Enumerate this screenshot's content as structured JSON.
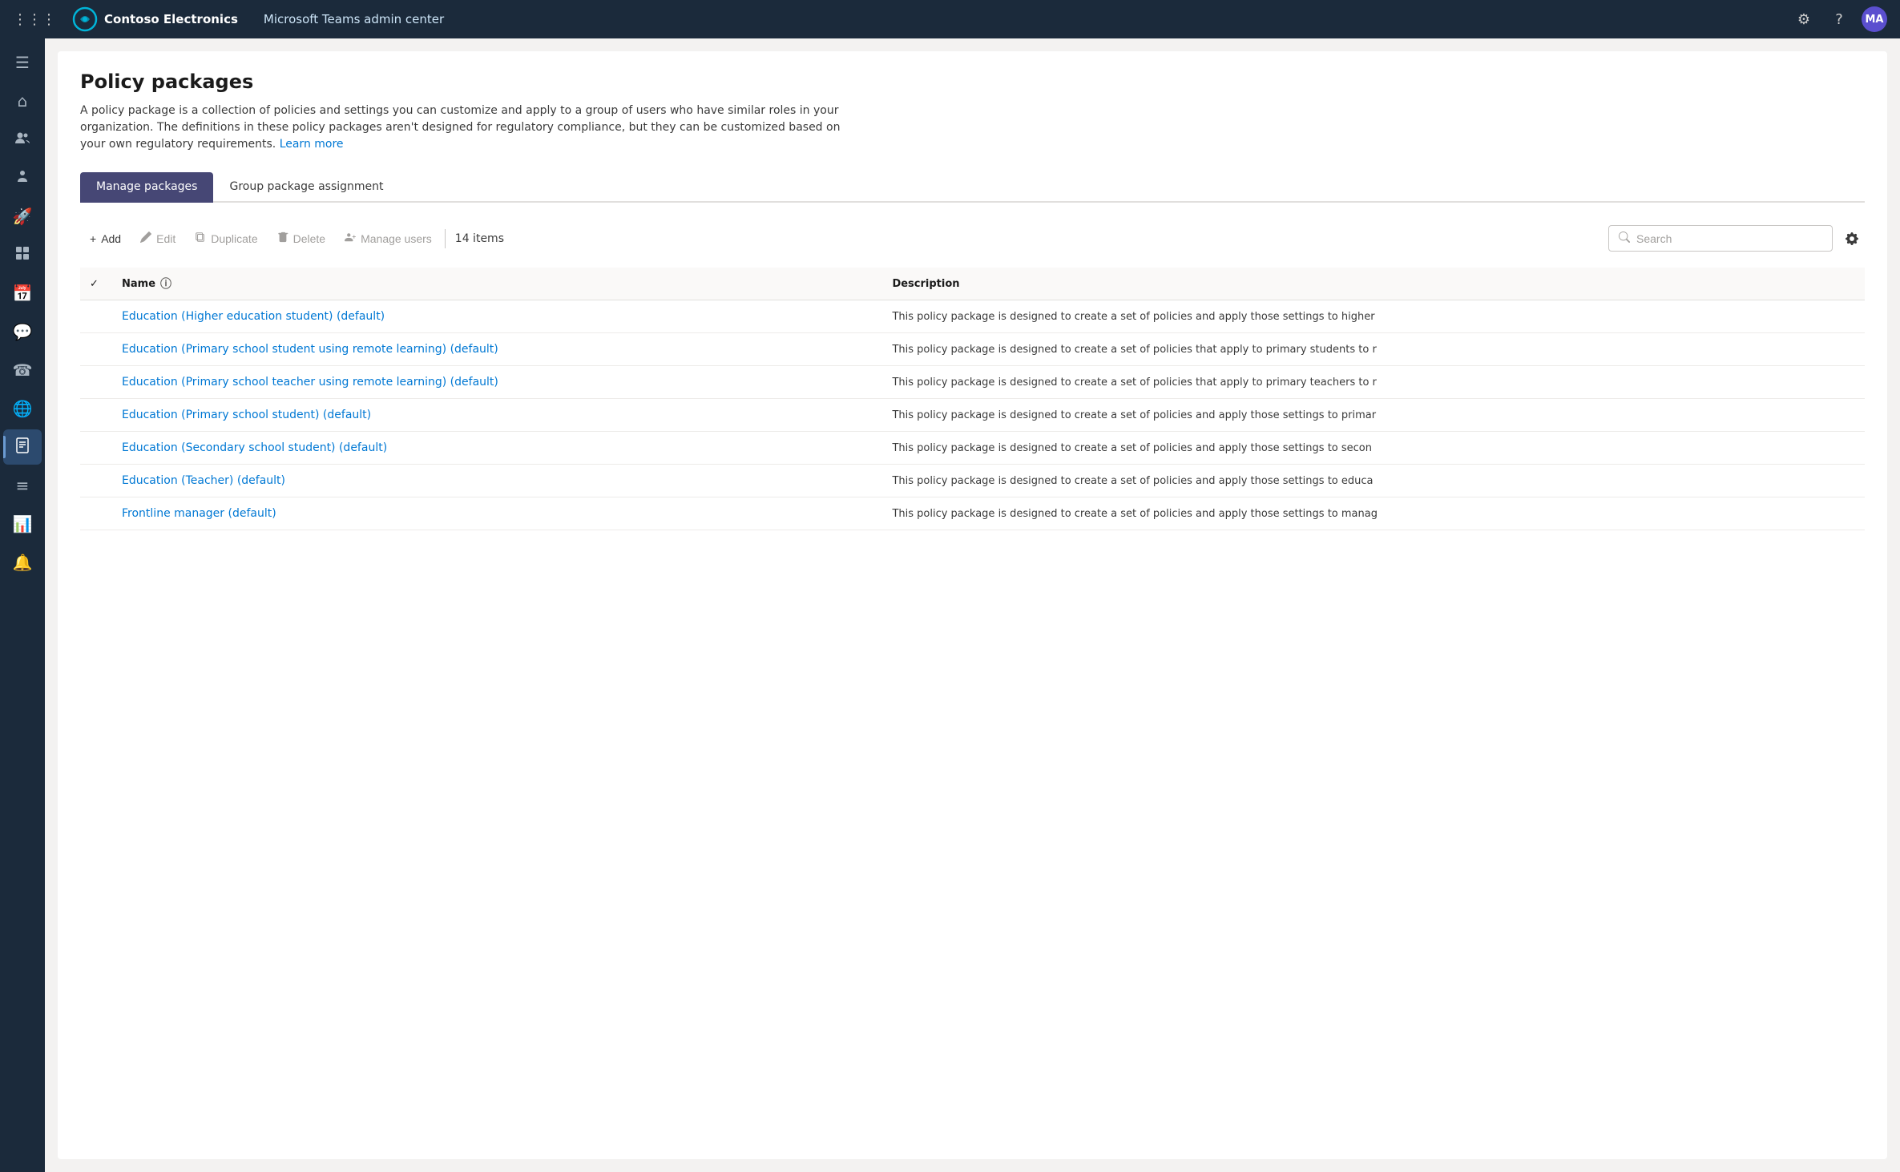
{
  "topnav": {
    "org_name": "Contoso Electronics",
    "app_name": "Microsoft Teams admin center",
    "avatar_initials": "MA",
    "grid_icon": "⊞"
  },
  "sidebar": {
    "items": [
      {
        "id": "menu",
        "icon": "☰",
        "label": "Menu"
      },
      {
        "id": "home",
        "icon": "⌂",
        "label": "Home"
      },
      {
        "id": "users",
        "icon": "👥",
        "label": "Users"
      },
      {
        "id": "teams",
        "icon": "👤",
        "label": "Teams"
      },
      {
        "id": "devices",
        "icon": "🚀",
        "label": "Devices"
      },
      {
        "id": "apps",
        "icon": "⊞",
        "label": "Apps"
      },
      {
        "id": "meetings",
        "icon": "📅",
        "label": "Meetings"
      },
      {
        "id": "messaging",
        "icon": "💬",
        "label": "Messaging"
      },
      {
        "id": "voice",
        "icon": "☎",
        "label": "Voice"
      },
      {
        "id": "locations",
        "icon": "🌐",
        "label": "Locations"
      },
      {
        "id": "policy",
        "icon": "📋",
        "label": "Policy packages",
        "active": true
      },
      {
        "id": "analytics",
        "icon": "≡",
        "label": "Analytics"
      },
      {
        "id": "reports",
        "icon": "📊",
        "label": "Reports"
      },
      {
        "id": "notifications",
        "icon": "🔔",
        "label": "Notifications"
      }
    ]
  },
  "page": {
    "title": "Policy packages",
    "description": "A policy package is a collection of policies and settings you can customize and apply to a group of users who have similar roles in your organization. The definitions in these policy packages aren't designed for regulatory compliance, but they can be customized based on your own regulatory requirements.",
    "learn_more": "Learn more"
  },
  "tabs": [
    {
      "id": "manage",
      "label": "Manage packages",
      "active": true
    },
    {
      "id": "group",
      "label": "Group package assignment",
      "active": false
    }
  ],
  "toolbar": {
    "add_label": "Add",
    "edit_label": "Edit",
    "duplicate_label": "Duplicate",
    "delete_label": "Delete",
    "manage_users_label": "Manage users",
    "item_count": "14 items",
    "search_placeholder": "Search",
    "add_icon": "+",
    "edit_icon": "✎",
    "duplicate_icon": "❑",
    "delete_icon": "🗑",
    "manage_users_icon": "👥"
  },
  "table": {
    "columns": [
      {
        "id": "name",
        "label": "Name"
      },
      {
        "id": "description",
        "label": "Description"
      }
    ],
    "rows": [
      {
        "name": "Education (Higher education student) (default)",
        "description": "This policy package is designed to create a set of policies and apply those settings to higher"
      },
      {
        "name": "Education (Primary school student using remote learning) (default)",
        "description": "This policy package is designed to create a set of policies that apply to primary students to r"
      },
      {
        "name": "Education (Primary school teacher using remote learning) (default)",
        "description": "This policy package is designed to create a set of policies that apply to primary teachers to r"
      },
      {
        "name": "Education (Primary school student) (default)",
        "description": "This policy package is designed to create a set of policies and apply those settings to primar"
      },
      {
        "name": "Education (Secondary school student) (default)",
        "description": "This policy package is designed to create a set of policies and apply those settings to secon"
      },
      {
        "name": "Education (Teacher) (default)",
        "description": "This policy package is designed to create a set of policies and apply those settings to educa"
      },
      {
        "name": "Frontline manager (default)",
        "description": "This policy package is designed to create a set of policies and apply those settings to manag"
      }
    ]
  }
}
